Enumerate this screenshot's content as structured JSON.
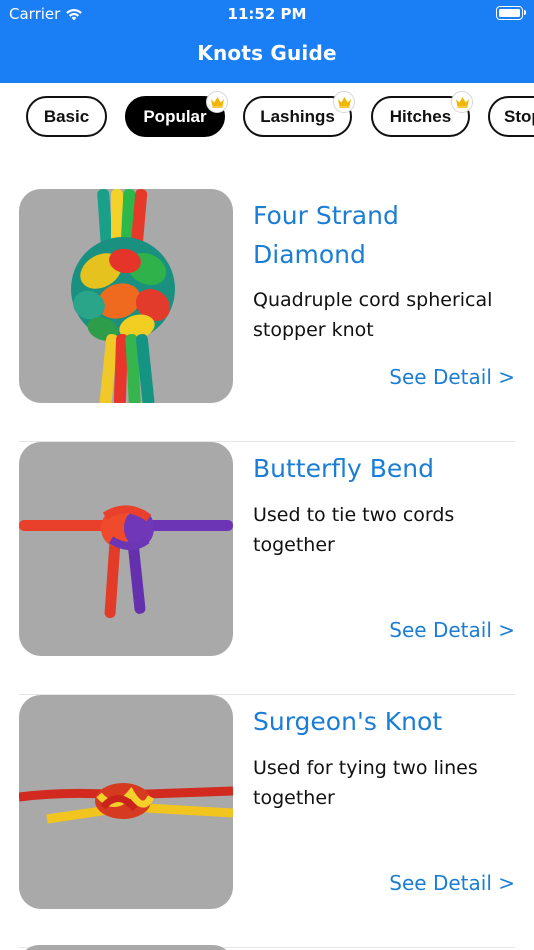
{
  "status_bar": {
    "carrier": "Carrier",
    "time": "11:52 PM"
  },
  "header": {
    "title": "Knots Guide",
    "background": "#1a7ff5"
  },
  "categories": [
    {
      "label": "Basic",
      "active": false,
      "premium": false
    },
    {
      "label": "Popular",
      "active": true,
      "premium": true
    },
    {
      "label": "Lashings",
      "active": false,
      "premium": true
    },
    {
      "label": "Hitches",
      "active": false,
      "premium": true
    },
    {
      "label": "Stop",
      "active": false,
      "premium": false
    }
  ],
  "knots": [
    {
      "title": "Four Strand Diamond",
      "description": "Quadruple cord spherical stopper knot",
      "detail_label": "See Detail >",
      "image": "four-strand-diamond-knot-photo"
    },
    {
      "title": "Butterfly Bend",
      "description": "Used to tie two cords together",
      "detail_label": "See Detail >",
      "image": "butterfly-bend-knot-photo"
    },
    {
      "title": "Surgeon's Knot",
      "description": "Used for tying two lines together",
      "detail_label": "See Detail >",
      "image": "surgeons-knot-photo"
    }
  ],
  "colors": {
    "accent": "#1b7ed4",
    "crown": "#f2b705",
    "image_bg": "#a9a9a9"
  }
}
